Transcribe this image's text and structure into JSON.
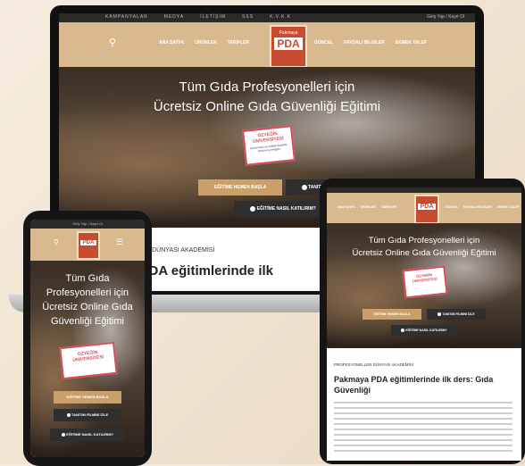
{
  "laptop": {
    "topbar_items": [
      "KAMPANYALAR",
      "MEDYA",
      "İLETİŞİM",
      "SSS",
      "K.V.K.K"
    ],
    "topbar_right": "Giriş Yap / Kayıt Ol",
    "nav_left": [
      "ANA SAYFA",
      "ÜRÜNLER",
      "TARİFLER"
    ],
    "nav_right": [
      "GÜNCEL",
      "FAYDALI BİLGİLER",
      "EKMEK TALEP"
    ],
    "logo_brand": "Pakmaya",
    "logo_text": "PDA",
    "title_line1": "Tüm Gıda Profesyonelleri için",
    "title_line2": "Ücretsiz Online Gıda Güvenliği Eğitimi",
    "stamp_top": "ÖZYEĞİN",
    "stamp_bottom": "ÜNİVERSİTESİ",
    "stamp_small": "Gastronomi ve Mutfak Sanatları Bölümü iş birliğiyle",
    "btn_start": "EĞİTİME HEMEN BAŞLA",
    "btn_promo": "TANITIM FİLMİNİ İZLE",
    "btn_how": "EĞİTİME NASIL KATILIRIM?",
    "section_label": "ELLER DÜNYASI AKADEMİSİ",
    "section_title": "a PDA eğitimlerinde ilk"
  },
  "phone": {
    "topbar": "Giriş Yap / Kayıt Ol",
    "title_line1": "Tüm Gıda",
    "title_line2": "Profesyonelleri için",
    "title_line3": "Ücretsiz Online Gıda",
    "title_line4": "Güvenliği Eğitimi",
    "stamp_top": "ÖZYEĞİN",
    "stamp_bottom": "ÜNİVERSİTESİ",
    "btn_start": "EĞİTİME HEMEN BAŞLA",
    "btn_promo": "TANITIM FİLMİNİ İZLE",
    "btn_how": "EĞİTİME NASIL KATILIRIM?"
  },
  "tablet": {
    "nav_left": [
      "ANA SAYFA",
      "ÜRÜNLER",
      "TARİFLER"
    ],
    "nav_right": [
      "GÜNCEL",
      "FAYDALI BİLGİLER",
      "EKMEK TALEP"
    ],
    "title_line1": "Tüm Gıda Profesyonelleri için",
    "title_line2": "Ücretsiz Online Gıda Güvenliği Eğitimi",
    "stamp_top": "ÖZYEĞİN",
    "stamp_bottom": "ÜNİVERSİTESİ",
    "btn_start": "EĞİTİME HEMEN BAŞLA",
    "btn_promo": "TANITIM FİLMİNİ İZLE",
    "btn_how": "EĞİTİME NASIL KATILIRIM?",
    "section_label": "PROFESYONELLER DÜNYASI AKADEMİSİ",
    "article_title_line1": "Pakmaya PDA eğitimlerinde ilk ders: Gıda",
    "article_title_line2": "Güvenliği"
  }
}
